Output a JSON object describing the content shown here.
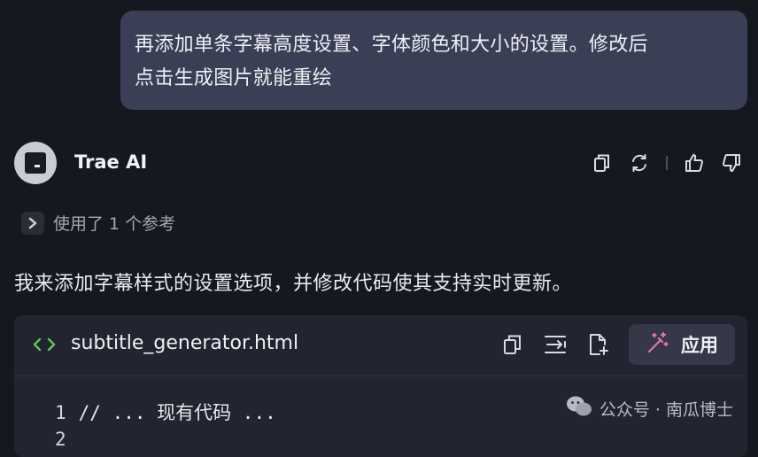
{
  "user_message": {
    "line1": "再添加单条字幕高度设置、字体颜色和大小的设置。修改后",
    "line2": "点击生成图片就能重绘"
  },
  "assistant": {
    "name": "Trae AI",
    "icons": [
      "copy-icon",
      "regenerate-icon",
      "thumbs-up-icon",
      "thumbs-down-icon"
    ]
  },
  "references": {
    "label": "使用了 1 个参考"
  },
  "reply_text": "我来添加字幕样式的设置选项，并修改代码使其支持实时更新。",
  "code_block": {
    "filename": "subtitle_generator.html",
    "apply_label": "应用",
    "lines": [
      {
        "no": "1",
        "text": "// ... 现有代码 ..."
      },
      {
        "no": "2",
        "text": ""
      }
    ],
    "icons": [
      "code-icon",
      "copy-icon",
      "insert-icon",
      "new-file-icon",
      "magic-wand-icon"
    ]
  },
  "watermark": {
    "text": "公众号 · 南瓜博士"
  },
  "colors": {
    "background": "#16181f",
    "user_bubble": "#3a3f55",
    "code_card": "#222530",
    "code_icon": "#62c554",
    "apply_icon": "#e8749a"
  }
}
